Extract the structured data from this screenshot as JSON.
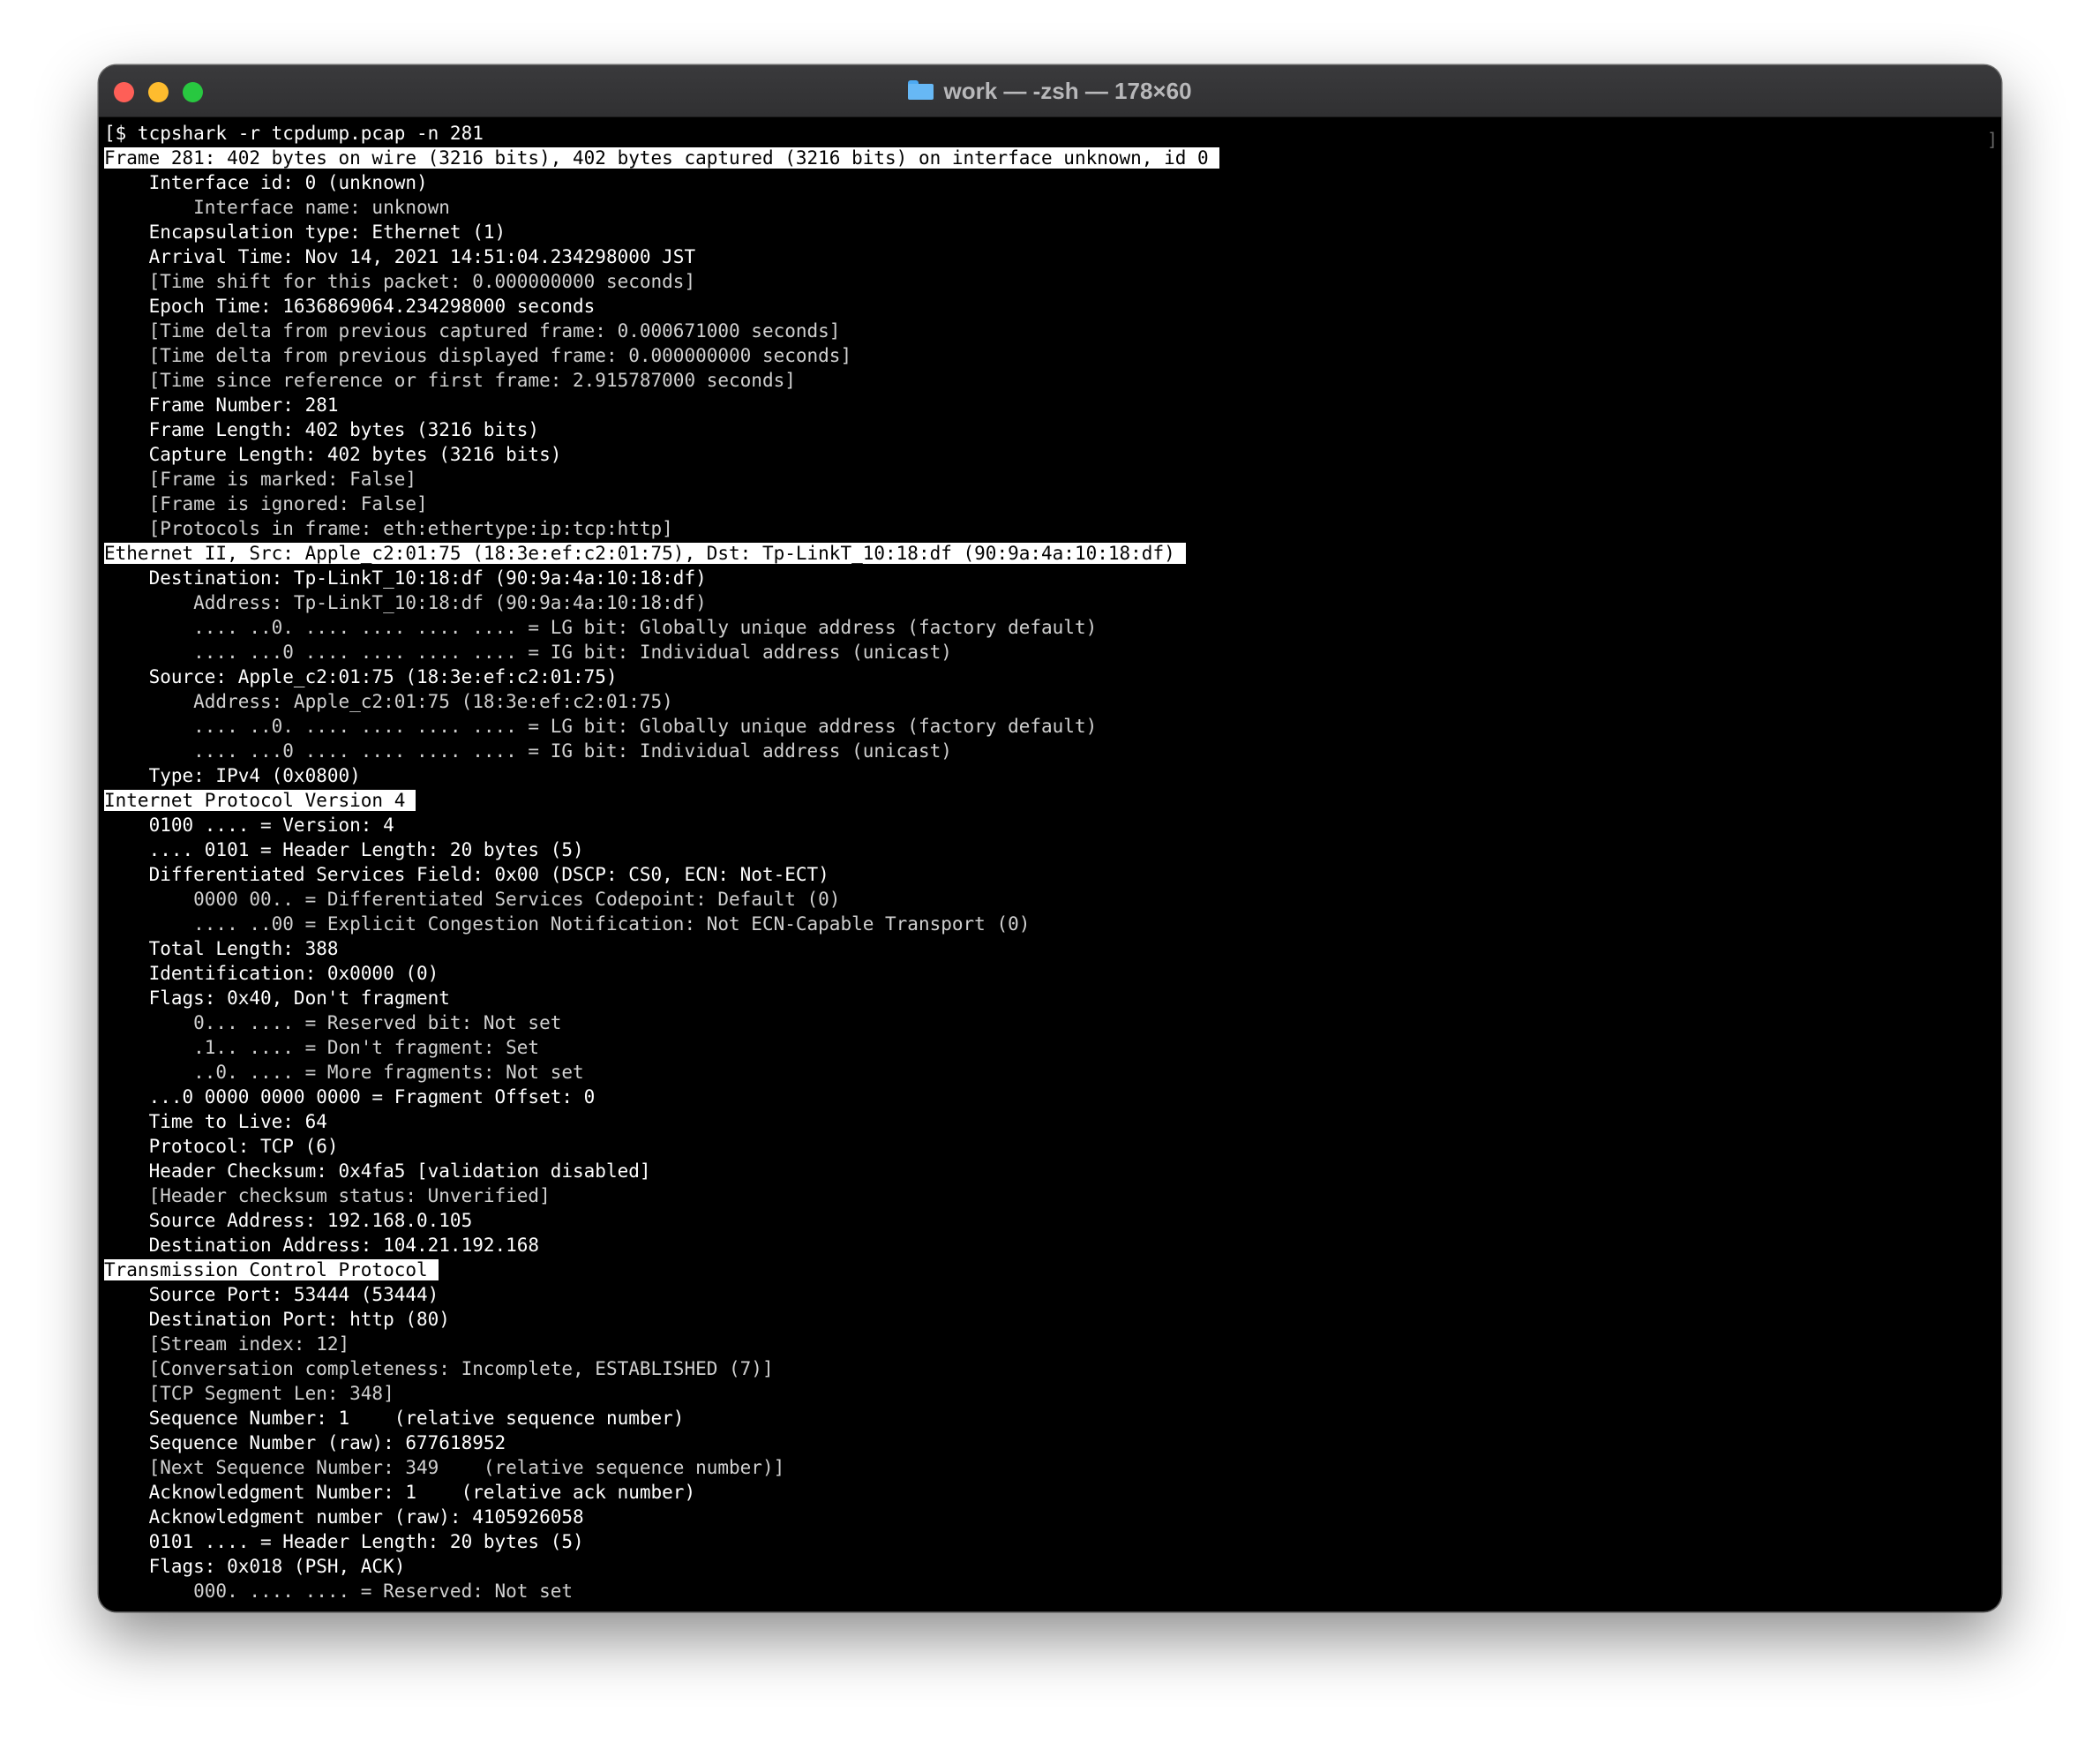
{
  "window": {
    "title": "work — -zsh — 178×60"
  },
  "terminal": {
    "lines": [
      {
        "text": "[$ tcpshark -r tcpdump.pcap -n 281",
        "style": "cmd"
      },
      {
        "text": "Frame 281: 402 bytes on wire (3216 bits), 402 bytes captured (3216 bits) on interface unknown, id 0",
        "style": "hl"
      },
      {
        "text": "    Interface id: 0 (unknown)",
        "style": "normal"
      },
      {
        "text": "        Interface name: unknown",
        "style": "dim"
      },
      {
        "text": "    Encapsulation type: Ethernet (1)",
        "style": "normal"
      },
      {
        "text": "    Arrival Time: Nov 14, 2021 14:51:04.234298000 JST",
        "style": "normal"
      },
      {
        "text": "    [Time shift for this packet: 0.000000000 seconds]",
        "style": "dim"
      },
      {
        "text": "    Epoch Time: 1636869064.234298000 seconds",
        "style": "normal"
      },
      {
        "text": "    [Time delta from previous captured frame: 0.000671000 seconds]",
        "style": "dim"
      },
      {
        "text": "    [Time delta from previous displayed frame: 0.000000000 seconds]",
        "style": "dim"
      },
      {
        "text": "    [Time since reference or first frame: 2.915787000 seconds]",
        "style": "dim"
      },
      {
        "text": "    Frame Number: 281",
        "style": "normal"
      },
      {
        "text": "    Frame Length: 402 bytes (3216 bits)",
        "style": "normal"
      },
      {
        "text": "    Capture Length: 402 bytes (3216 bits)",
        "style": "normal"
      },
      {
        "text": "    [Frame is marked: False]",
        "style": "dim"
      },
      {
        "text": "    [Frame is ignored: False]",
        "style": "dim"
      },
      {
        "text": "    [Protocols in frame: eth:ethertype:ip:tcp:http]",
        "style": "dim"
      },
      {
        "text": "Ethernet II, Src: Apple_c2:01:75 (18:3e:ef:c2:01:75), Dst: Tp-LinkT_10:18:df (90:9a:4a:10:18:df)",
        "style": "hl"
      },
      {
        "text": "    Destination: Tp-LinkT_10:18:df (90:9a:4a:10:18:df)",
        "style": "normal"
      },
      {
        "text": "        Address: Tp-LinkT_10:18:df (90:9a:4a:10:18:df)",
        "style": "dim"
      },
      {
        "text": "        .... ..0. .... .... .... .... = LG bit: Globally unique address (factory default)",
        "style": "dim"
      },
      {
        "text": "        .... ...0 .... .... .... .... = IG bit: Individual address (unicast)",
        "style": "dim"
      },
      {
        "text": "    Source: Apple_c2:01:75 (18:3e:ef:c2:01:75)",
        "style": "normal"
      },
      {
        "text": "        Address: Apple_c2:01:75 (18:3e:ef:c2:01:75)",
        "style": "dim"
      },
      {
        "text": "        .... ..0. .... .... .... .... = LG bit: Globally unique address (factory default)",
        "style": "dim"
      },
      {
        "text": "        .... ...0 .... .... .... .... = IG bit: Individual address (unicast)",
        "style": "dim"
      },
      {
        "text": "    Type: IPv4 (0x0800)",
        "style": "normal"
      },
      {
        "text": "Internet Protocol Version 4",
        "style": "hl"
      },
      {
        "text": "    0100 .... = Version: 4",
        "style": "normal"
      },
      {
        "text": "    .... 0101 = Header Length: 20 bytes (5)",
        "style": "normal"
      },
      {
        "text": "    Differentiated Services Field: 0x00 (DSCP: CS0, ECN: Not-ECT)",
        "style": "normal"
      },
      {
        "text": "        0000 00.. = Differentiated Services Codepoint: Default (0)",
        "style": "dim"
      },
      {
        "text": "        .... ..00 = Explicit Congestion Notification: Not ECN-Capable Transport (0)",
        "style": "dim"
      },
      {
        "text": "    Total Length: 388",
        "style": "normal"
      },
      {
        "text": "    Identification: 0x0000 (0)",
        "style": "normal"
      },
      {
        "text": "    Flags: 0x40, Don't fragment",
        "style": "normal"
      },
      {
        "text": "        0... .... = Reserved bit: Not set",
        "style": "dim"
      },
      {
        "text": "        .1.. .... = Don't fragment: Set",
        "style": "dim"
      },
      {
        "text": "        ..0. .... = More fragments: Not set",
        "style": "dim"
      },
      {
        "text": "    ...0 0000 0000 0000 = Fragment Offset: 0",
        "style": "normal"
      },
      {
        "text": "    Time to Live: 64",
        "style": "normal"
      },
      {
        "text": "    Protocol: TCP (6)",
        "style": "normal"
      },
      {
        "text": "    Header Checksum: 0x4fa5 [validation disabled]",
        "style": "normal"
      },
      {
        "text": "    [Header checksum status: Unverified]",
        "style": "dim"
      },
      {
        "text": "    Source Address: 192.168.0.105",
        "style": "normal"
      },
      {
        "text": "    Destination Address: 104.21.192.168",
        "style": "normal"
      },
      {
        "text": "Transmission Control Protocol",
        "style": "hl"
      },
      {
        "text": "    Source Port: 53444 (53444)",
        "style": "normal"
      },
      {
        "text": "    Destination Port: http (80)",
        "style": "normal"
      },
      {
        "text": "    [Stream index: 12]",
        "style": "dim"
      },
      {
        "text": "    [Conversation completeness: Incomplete, ESTABLISHED (7)]",
        "style": "dim"
      },
      {
        "text": "    [TCP Segment Len: 348]",
        "style": "dim"
      },
      {
        "text": "    Sequence Number: 1    (relative sequence number)",
        "style": "normal"
      },
      {
        "text": "    Sequence Number (raw): 677618952",
        "style": "normal"
      },
      {
        "text": "    [Next Sequence Number: 349    (relative sequence number)]",
        "style": "dim"
      },
      {
        "text": "    Acknowledgment Number: 1    (relative ack number)",
        "style": "normal"
      },
      {
        "text": "    Acknowledgment number (raw): 4105926058",
        "style": "normal"
      },
      {
        "text": "    0101 .... = Header Length: 20 bytes (5)",
        "style": "normal"
      },
      {
        "text": "    Flags: 0x018 (PSH, ACK)",
        "style": "normal"
      },
      {
        "text": "        000. .... .... = Reserved: Not set",
        "style": "dim"
      }
    ],
    "scroll_marker": "]"
  }
}
